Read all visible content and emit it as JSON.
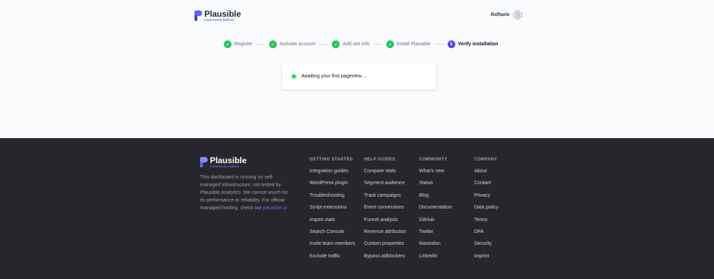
{
  "brand": {
    "name": "Plausible",
    "edition": "Community Edition",
    "accent": "#6366f1"
  },
  "user": {
    "name": "Raffaele",
    "avatar_icon": "identicon"
  },
  "steps": [
    {
      "label": "Register",
      "status": "done",
      "icon": "check-icon"
    },
    {
      "label": "Activate account",
      "status": "done",
      "icon": "check-icon"
    },
    {
      "label": "Add site info",
      "status": "done",
      "icon": "check-icon"
    },
    {
      "label": "Install Plausible",
      "status": "done",
      "icon": "check-icon"
    },
    {
      "label": "Verify installation",
      "status": "active",
      "number": "5"
    }
  ],
  "verification": {
    "message": "Awaiting your first pageview ..."
  },
  "footer": {
    "disclaimer_prefix": "This dashboard is running on self-managed infrastructure, not tested by Plausible Analytics. We cannot vouch for its performance or reliability. For official managed hosting, check out ",
    "disclaimer_link": "plausible.io",
    "columns": [
      {
        "heading": "GETTING STARTED",
        "links": [
          "Integration guides",
          "WordPress plugin",
          "Troubleshooting",
          "Script extensions",
          "Import stats",
          "Search Console",
          "Invite team members",
          "Exclude traffic"
        ]
      },
      {
        "heading": "HELP GUIDES",
        "links": [
          "Compare stats",
          "Segment audience",
          "Track campaigns",
          "Event conversions",
          "Funnel analysis",
          "Revenue attribution",
          "Custom properties",
          "Bypass adblockers"
        ]
      },
      {
        "heading": "COMMUNITY",
        "links": [
          "What's new",
          "Status",
          "Blog",
          "Documentation",
          "GitHub",
          "Twitter",
          "Mastodon",
          "LinkedIn"
        ]
      },
      {
        "heading": "COMPANY",
        "links": [
          "About",
          "Contact",
          "Privacy",
          "Data policy",
          "Terms",
          "DPA",
          "Security",
          "Imprint"
        ]
      }
    ]
  },
  "colors": {
    "step_done": "#22c55e",
    "step_active": "#4f46e5",
    "footer_bg": "#26262c"
  }
}
